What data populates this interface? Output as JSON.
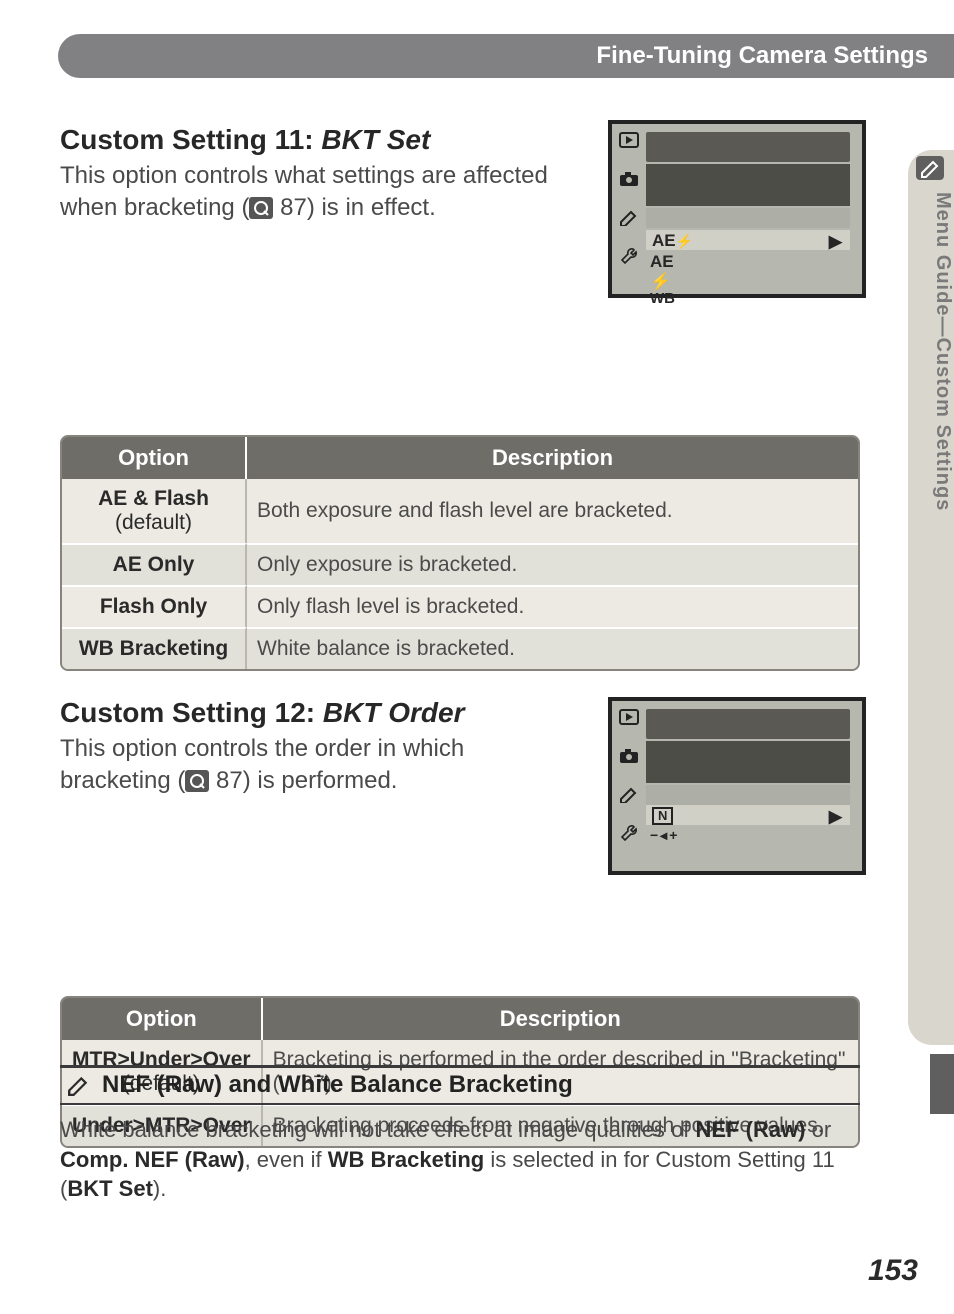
{
  "header": {
    "title": "Fine-Tuning Camera Settings"
  },
  "side_tab": {
    "label": "Menu Guide—Custom Settings"
  },
  "section_11": {
    "heading_prefix": "Custom Setting 11: ",
    "heading_name": "BKT Set",
    "intro_before": "This option controls what settings are affected when bracketing (",
    "intro_ref": " 87",
    "intro_after": ") is in effect.",
    "lcd": {
      "rows": [
        "AE",
        "AE",
        "WB"
      ],
      "row1_extra": "⚡",
      "row3_glyph": "⚡"
    },
    "table": {
      "header_option": "Option",
      "header_desc": "Description",
      "rows": [
        {
          "opt_bold": "AE & Flash",
          "opt_sub": "(default)",
          "desc": "Both exposure and flash level are bracketed."
        },
        {
          "opt_bold": "AE Only",
          "opt_sub": "",
          "desc": "Only exposure is bracketed."
        },
        {
          "opt_bold": "Flash Only",
          "opt_sub": "",
          "desc": "Only flash level is bracketed."
        },
        {
          "opt_bold": "WB Bracketing",
          "opt_sub": "",
          "desc": "White balance is bracketed."
        }
      ]
    }
  },
  "section_12": {
    "heading_prefix": "Custom Setting 12: ",
    "heading_name": "BKT Order",
    "intro_before": "This option controls the order in which bracketing (",
    "intro_ref": " 87",
    "intro_after": ") is performed.",
    "lcd": {
      "rows": [
        "N",
        "−◂+"
      ],
      "row1_boxed": true
    },
    "table": {
      "header_option": "Option",
      "header_desc": "Description",
      "rows": [
        {
          "opt_bold": "MTR>Under>Over",
          "opt_sub": "(default)",
          "desc_before": "Bracketing is performed in the order described in \"Bracketing\" (",
          "desc_ref": " 87",
          "desc_after": ")."
        },
        {
          "opt_bold": "Under>MTR>Over",
          "opt_sub": "",
          "desc": "Bracketing proceeds from negative through positive values."
        }
      ]
    }
  },
  "callout": {
    "title": "NEF (Raw) and White Balance Bracketing",
    "body_parts": {
      "a": "White balance bracketing will not take effect at image qualities of ",
      "b": "NEF (Raw)",
      "c": " or ",
      "d": "Comp. NEF (Raw)",
      "e": ", even if ",
      "f": "WB Bracketing",
      "g": " is selected in for Custom Setting 11 (",
      "h": "BKT Set",
      "i": ")."
    }
  },
  "page_number": "153"
}
